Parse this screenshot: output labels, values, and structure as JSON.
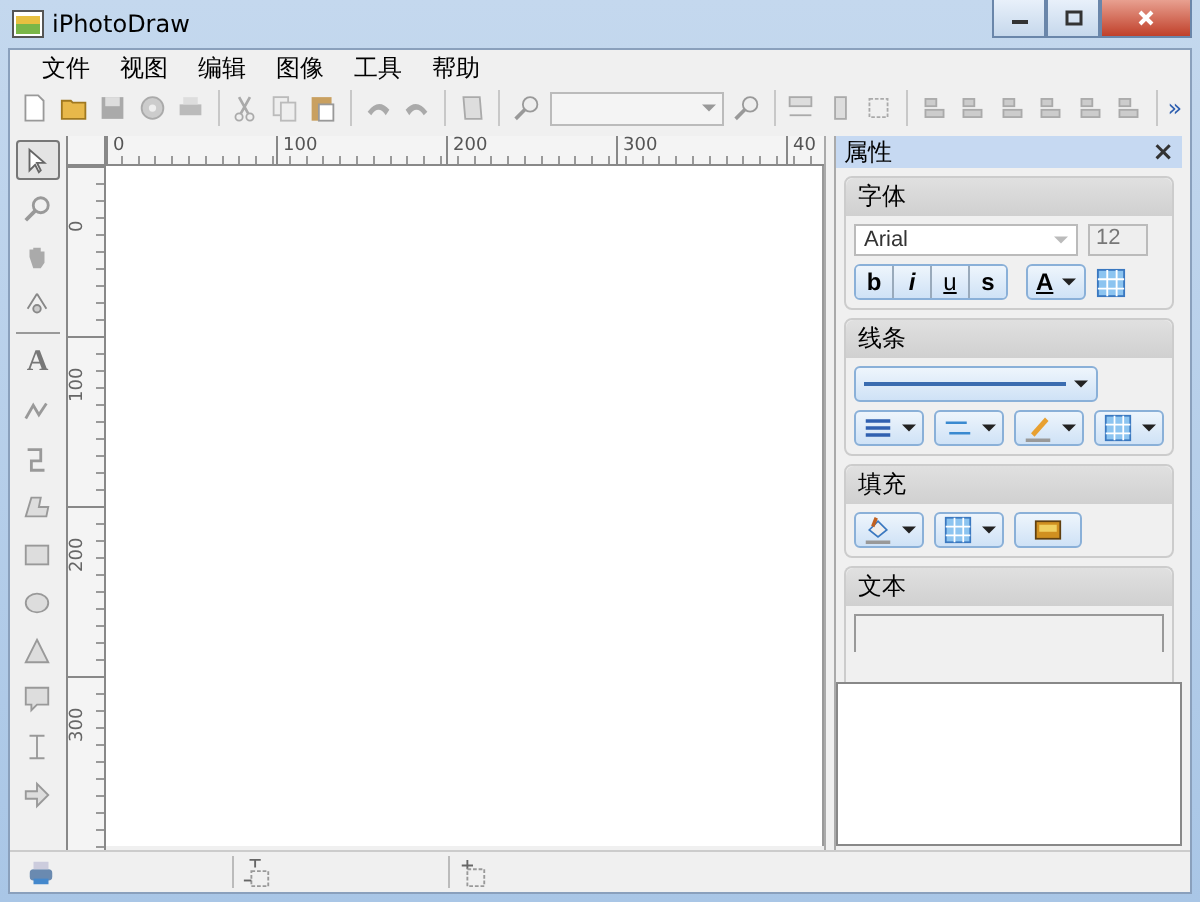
{
  "window": {
    "title": "iPhotoDraw"
  },
  "menu": [
    "文件",
    "视图",
    "编辑",
    "图像",
    "工具",
    "帮助"
  ],
  "toolbar": {
    "overflow": "»"
  },
  "tools": [
    {
      "kind": "pointer",
      "selected": true
    },
    {
      "kind": "zoom",
      "selected": false
    },
    {
      "kind": "hand",
      "selected": false
    },
    {
      "kind": "pen",
      "selected": false
    },
    {
      "kind": "text",
      "label": "A",
      "selected": false
    },
    {
      "kind": "freehand",
      "selected": false
    },
    {
      "kind": "connector",
      "selected": false
    },
    {
      "kind": "polygon",
      "selected": false
    },
    {
      "kind": "rectangle",
      "selected": false
    },
    {
      "kind": "ellipse",
      "selected": false
    },
    {
      "kind": "triangle",
      "selected": false
    },
    {
      "kind": "callout",
      "selected": false
    },
    {
      "kind": "dimension",
      "selected": false
    },
    {
      "kind": "arrow",
      "selected": false
    }
  ],
  "ruler": {
    "horizontal": [
      "0",
      "100",
      "200",
      "300",
      "40"
    ],
    "vertical": [
      "0",
      "100",
      "200",
      "300"
    ]
  },
  "properties": {
    "title": "属性",
    "close": "×",
    "font": {
      "heading": "字体",
      "family": "Arial",
      "size": "12",
      "styles": [
        "b",
        "i",
        "u",
        "s"
      ],
      "color_label": "A"
    },
    "line": {
      "heading": "线条"
    },
    "fill": {
      "heading": "填充"
    },
    "text": {
      "heading": "文本"
    }
  }
}
